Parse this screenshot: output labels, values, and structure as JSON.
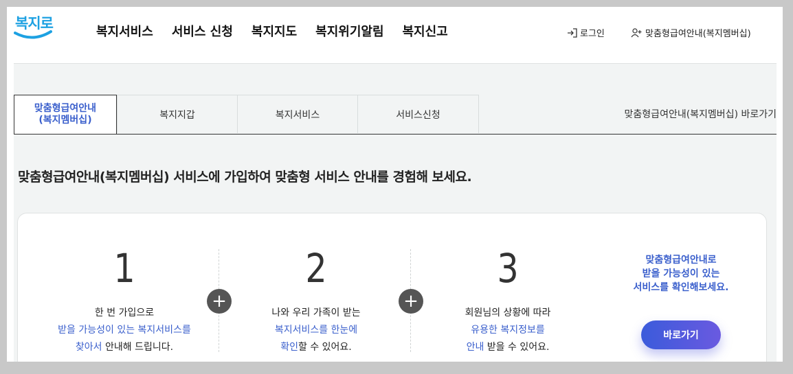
{
  "logo": {
    "text": "복지로"
  },
  "gnb": [
    "복지서비스",
    "서비스 신청",
    "복지지도",
    "복지위기알림",
    "복지신고"
  ],
  "util": {
    "login": "로그인",
    "membership": "맞춤형급여안내(복지멤버십)"
  },
  "tabs": {
    "active_line1": "맞춤형급여안내",
    "active_line2": "(복지멤버십)",
    "wallet": "복지지갑",
    "services": "복지서비스",
    "apply": "서비스신청",
    "shortcut": "맞춤형급여안내(복지멤버십) 바로가기"
  },
  "intro": "맞춤형급여안내(복지멤버십) 서비스에 가입하여 맞춤형 서비스 안내를 경험해 보세요.",
  "steps": [
    {
      "num": "1",
      "l1": "한 번 가입으로",
      "l2": "받을 가능성이 있는 복지서비스를",
      "l3a": "찾아서",
      "l3b": " 안내해 드립니다."
    },
    {
      "num": "2",
      "l1": "나와 우리 가족이 받는",
      "l2": "복지서비스를 한눈에",
      "l3a": "확인",
      "l3b": "할 수 있어요."
    },
    {
      "num": "3",
      "l1": "회원님의 상황에 따라",
      "l2": "유용한 복지정보를",
      "l3a": "안내",
      "l3b": " 받을 수 있어요."
    }
  ],
  "cta": {
    "l1": "맞춤형급여안내로",
    "l2": "받을 가능성이 있는",
    "l3": "서비스를 확인해보세요.",
    "button": "바로가기"
  },
  "colors": {
    "accent": "#3a5fcc",
    "logo": "#1da1e2",
    "background": "#f2f4f4"
  }
}
